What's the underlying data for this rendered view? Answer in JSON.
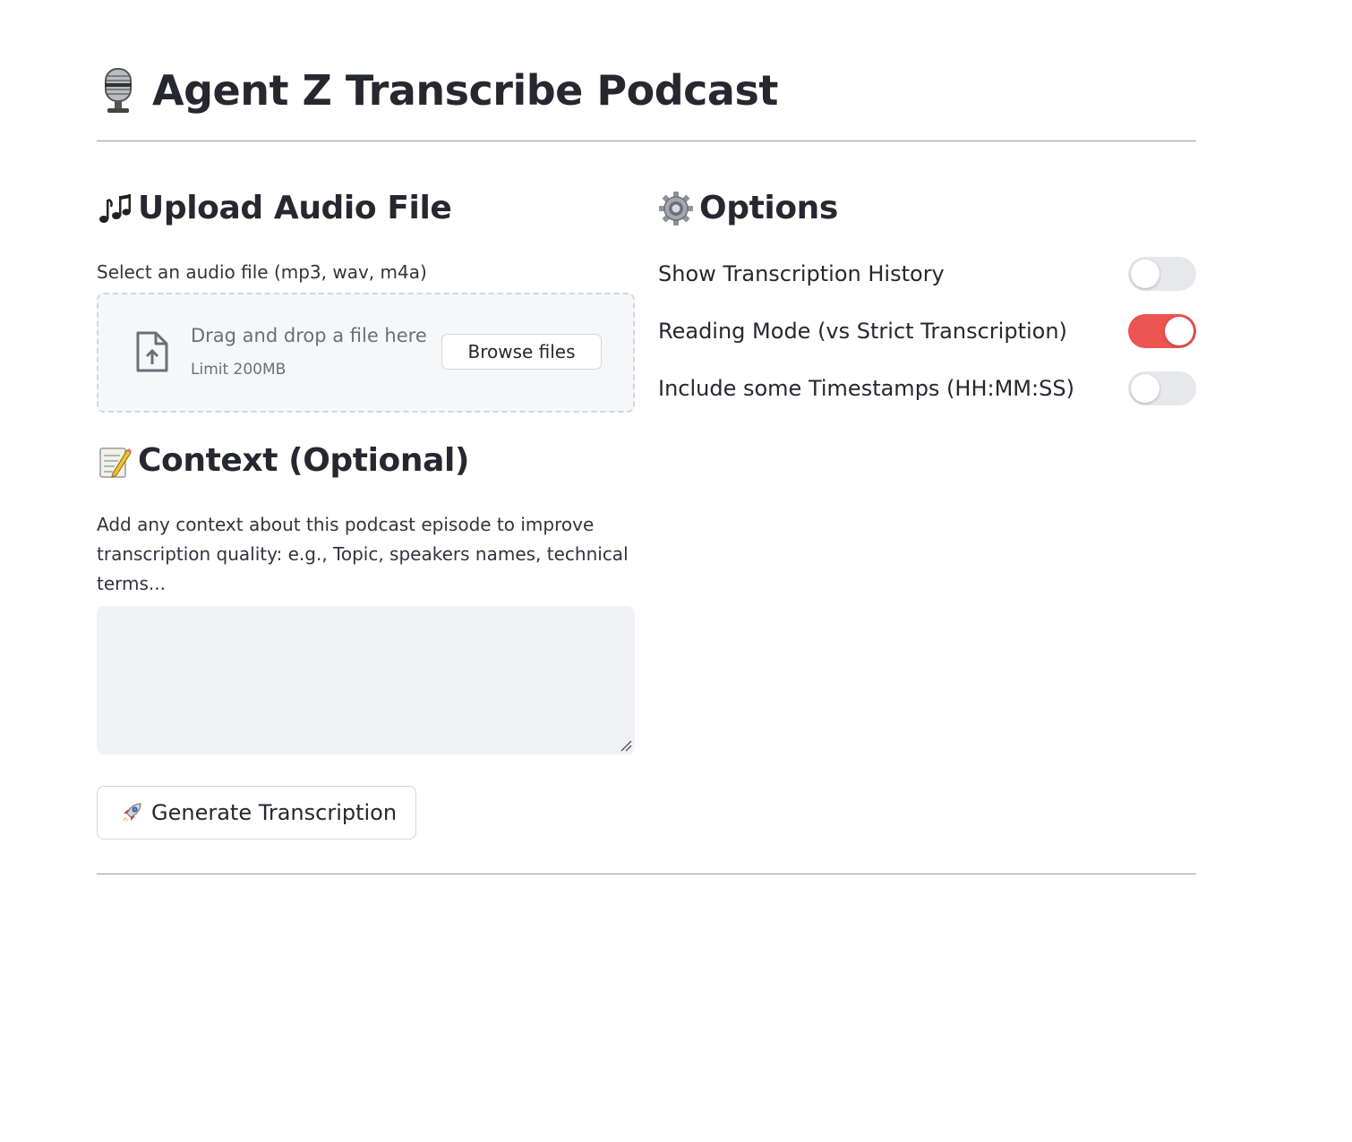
{
  "header": {
    "title": "Agent Z Transcribe Podcast",
    "title_icon": "microphone-icon"
  },
  "upload": {
    "heading": "Upload Audio File",
    "heading_icon": "music-notes-icon",
    "label": "Select an audio file (mp3, wav, m4a)",
    "dropzone_text": "Drag and drop a file here",
    "limit_text": "Limit 200MB",
    "browse_label": "Browse files",
    "file_icon": "file-upload-icon"
  },
  "context": {
    "heading": "Context (Optional)",
    "heading_icon": "memo-icon",
    "label": "Add any context about this podcast episode to improve transcription quality: e.g., Topic, speakers names, technical terms...",
    "value": ""
  },
  "generate": {
    "label": "Generate Transcription",
    "icon": "rocket-icon"
  },
  "options": {
    "heading": "Options",
    "heading_icon": "gear-icon",
    "items": [
      {
        "label": "Show Transcription History",
        "enabled": false
      },
      {
        "label": "Reading Mode (vs Strict Transcription)",
        "enabled": true
      },
      {
        "label": "Include some Timestamps (HH:MM:SS)",
        "enabled": false
      }
    ]
  },
  "colors": {
    "toggle_on": "#ea5451",
    "toggle_off": "#e6e8ec",
    "text": "#262730",
    "muted_text": "#6c6f7a"
  }
}
